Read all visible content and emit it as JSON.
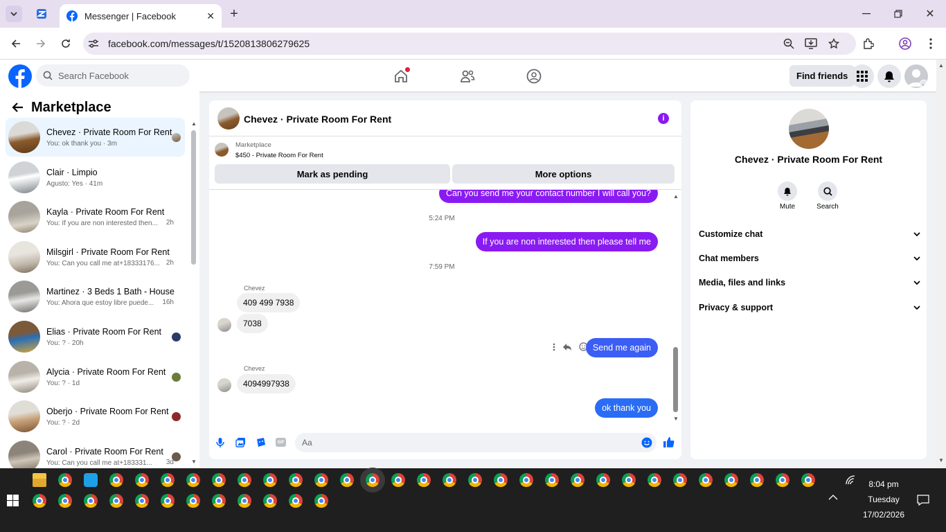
{
  "browser": {
    "tab_title": "Messenger | Facebook",
    "url": "facebook.com/messages/t/1520813806279625"
  },
  "header": {
    "search_placeholder": "Search Facebook",
    "find_friends": "Find friends"
  },
  "left_panel": {
    "title": "Marketplace",
    "conversations": [
      {
        "name": "Chevez · Private Room For Rent",
        "snippet": "You: ok thank you · 3m",
        "active": true
      },
      {
        "name": "Clair · Limpio",
        "snippet": "Agusto: Yes · 41m"
      },
      {
        "name": "Kayla · Private Room For Rent",
        "snippet": "You: If you are non interested then...",
        "time": "2h"
      },
      {
        "name": "Milsgirl · Private Room For Rent",
        "snippet": "You: Can you call me at+18333176...",
        "time": "2h"
      },
      {
        "name": "Martinez · 3 Beds 1 Bath - House",
        "snippet": "You: Ahora que estoy libre puede...",
        "time": "16h"
      },
      {
        "name": "Elias · Private Room For Rent",
        "snippet": "You: ? · 20h"
      },
      {
        "name": "Alycia · Private Room For Rent",
        "snippet": "You: ? · 1d"
      },
      {
        "name": "Oberjo · Private Room For Rent",
        "snippet": "You: ? · 2d"
      },
      {
        "name": "Carol · Private Room For Rent",
        "snippet": "You: Can you call me at+183331...",
        "time": "3d"
      }
    ]
  },
  "chat": {
    "title": "Chevez · Private Room For Rent",
    "listing_source": "Marketplace",
    "listing": "$450 - Private Room For Rent",
    "mark_pending": "Mark as pending",
    "more_options": "More options",
    "messages": {
      "m1": "Can you send me your contact number I will call you?",
      "ts1": "5:24 PM",
      "m2": "If you are non interested then please tell me",
      "ts2": "7:59 PM",
      "sender1": "Chevez",
      "m3": "409 499 7938",
      "m4": "7038",
      "m5": "Send me again",
      "sender2": "Chevez",
      "m6": "4094997938",
      "m7": "ok thank you"
    },
    "composer_placeholder": "Aa"
  },
  "info_panel": {
    "name": "Chevez · Private Room For Rent",
    "mute": "Mute",
    "search": "Search",
    "sections": [
      "Customize chat",
      "Chat members",
      "Media, files and links",
      "Privacy & support"
    ]
  },
  "taskbar": {
    "time": "8:04 pm",
    "day": "Tuesday",
    "date": "17/02/2026"
  },
  "colors": {
    "fb_blue": "#0866ff",
    "purple_bubble": "#8a1af2",
    "blue_bubble": "#2b5cf5"
  }
}
